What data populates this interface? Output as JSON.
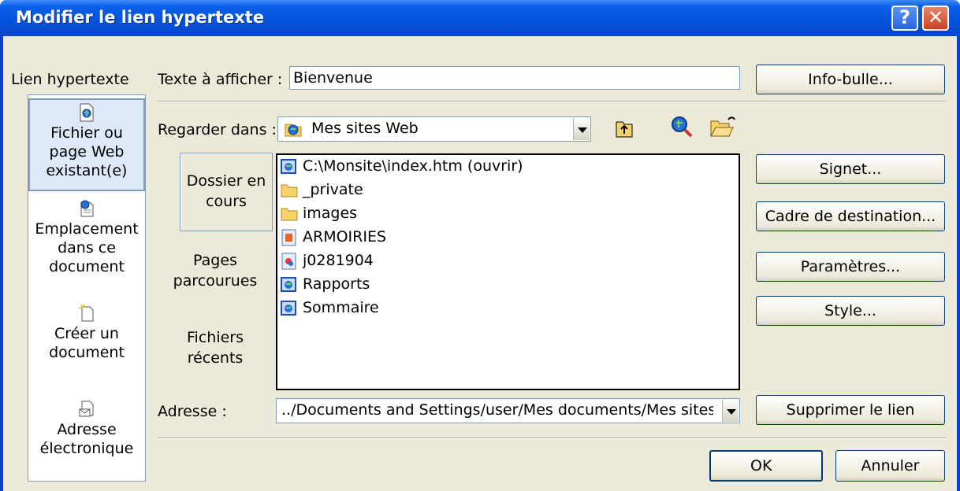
{
  "window": {
    "title": "Modifier le lien hypertexte",
    "help_icon": "help-icon",
    "close_icon": "close-icon"
  },
  "link_section": {
    "label": "Lien hypertexte",
    "items": [
      {
        "line1": "Fichier ou",
        "line2": "page Web",
        "line3": "existant(e)",
        "icon": "webpage-file-icon",
        "selected": true
      },
      {
        "line1": "Emplacement",
        "line2": "dans ce",
        "line3": "document",
        "icon": "document-location-icon",
        "selected": false
      },
      {
        "line1": "Créer un",
        "line2": "document",
        "icon": "new-document-icon",
        "selected": false
      },
      {
        "line1": "Adresse",
        "line2": "électronique",
        "icon": "email-icon",
        "selected": false
      }
    ]
  },
  "display_text": {
    "label": "Texte à afficher :",
    "value": "Bienvenue"
  },
  "look_in": {
    "label": "Regarder dans :",
    "value": "Mes sites Web",
    "icon": "web-folder-icon",
    "tools": [
      "up-folder-icon",
      "web-search-icon",
      "open-folder-icon"
    ]
  },
  "subnav": [
    {
      "line1": "Dossier en",
      "line2": "cours",
      "selected": true
    },
    {
      "line1": "Pages",
      "line2": "parcourues",
      "selected": false
    },
    {
      "line1": "Fichiers",
      "line2": "récents",
      "selected": false
    }
  ],
  "files": [
    {
      "name": "C:\\Monsite\\index.htm (ouvrir)",
      "icon": "web-project-icon"
    },
    {
      "name": "_private",
      "icon": "folder-icon"
    },
    {
      "name": "images",
      "icon": "folder-icon"
    },
    {
      "name": "ARMOIRIES",
      "icon": "image-file-icon"
    },
    {
      "name": "j0281904",
      "icon": "clipart-file-icon"
    },
    {
      "name": "Rapports",
      "icon": "web-project-icon"
    },
    {
      "name": "Sommaire",
      "icon": "web-project-icon"
    }
  ],
  "address": {
    "label": "Adresse :",
    "value": "../Documents and Settings/user/Mes documents/Mes sites W"
  },
  "buttons": {
    "tooltip": "Info-bulle...",
    "bookmark": "Signet...",
    "target_frame": "Cadre de destination...",
    "parameters": "Paramètres...",
    "style": "Style...",
    "remove_link": "Supprimer le lien",
    "ok": "OK",
    "cancel": "Annuler"
  }
}
